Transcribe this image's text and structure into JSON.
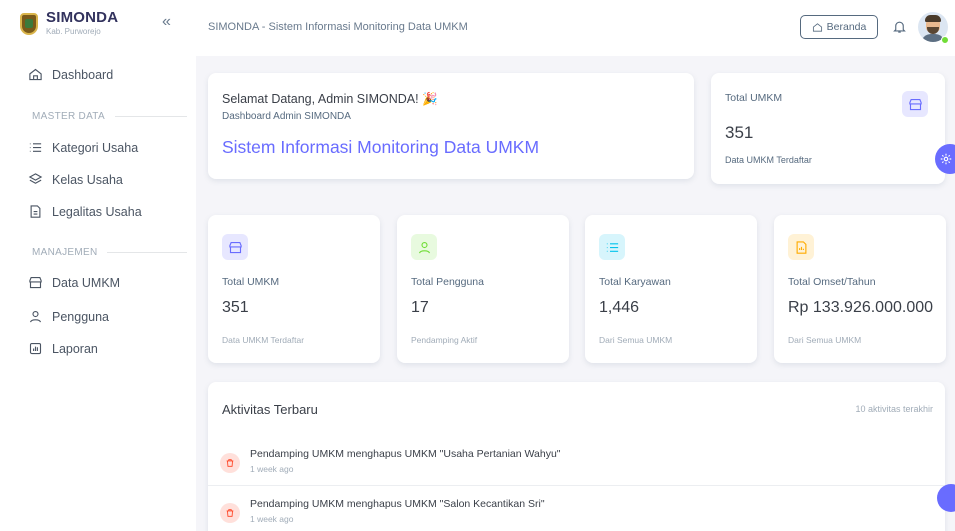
{
  "brand": {
    "name": "SIMONDA",
    "sub": "Kab. Purworejo"
  },
  "sidebar": {
    "collapse": "«",
    "dashboard": "Dashboard",
    "master_header": "MASTER DATA",
    "master_items": [
      "Kategori Usaha",
      "Kelas Usaha",
      "Legalitas Usaha"
    ],
    "manage_header": "MANAJEMEN",
    "manage_items": [
      "Data UMKM",
      "Pengguna",
      "Laporan"
    ]
  },
  "topbar": {
    "title": "SIMONDA - Sistem Informasi Monitoring Data UMKM",
    "beranda": "Beranda"
  },
  "welcome": {
    "heading": "Selamat Datang, Admin SIMONDA! 🎉",
    "subheading": "Dashboard Admin SIMONDA",
    "title": "Sistem Informasi Monitoring Data UMKM"
  },
  "total_top": {
    "label": "Total UMKM",
    "value": "351",
    "sub": "Data UMKM Terdaftar"
  },
  "stats": [
    {
      "label": "Total UMKM",
      "value": "351",
      "sub": "Data UMKM Terdaftar"
    },
    {
      "label": "Total Pengguna",
      "value": "17",
      "sub": "Pendamping Aktif"
    },
    {
      "label": "Total Karyawan",
      "value": "1,446",
      "sub": "Dari Semua UMKM"
    },
    {
      "label": "Total Omset/Tahun",
      "value": "Rp 133.926.000.000",
      "sub": "Dari Semua UMKM"
    }
  ],
  "colors": {
    "primary": "#696cff",
    "success": "#71dd37",
    "info": "#03c3ec",
    "warning": "#ffab00",
    "danger": "#ff3e1d"
  },
  "activity": {
    "title": "Aktivitas Terbaru",
    "meta": "10 aktivitas terakhir",
    "items": [
      {
        "text": "Pendamping UMKM menghapus UMKM \"Usaha Pertanian Wahyu\"",
        "time": "1 week ago"
      },
      {
        "text": "Pendamping UMKM menghapus UMKM \"Salon Kecantikan Sri\"",
        "time": "1 week ago"
      }
    ]
  }
}
